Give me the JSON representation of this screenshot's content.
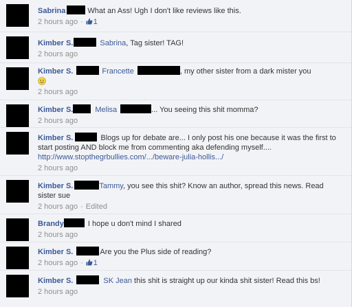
{
  "comments": [
    {
      "name": "Sabrina",
      "tag": "",
      "text": "What an Ass! Ugh I don't like reviews like this.",
      "time": "2 hours ago",
      "likes": "1"
    },
    {
      "name": "Kimber S.",
      "tag": "Sabrina",
      "text": ", Tag sister! TAG!",
      "time": "2 hours ago"
    },
    {
      "name": "Kimber S.",
      "tag": "Francette",
      "text": ", my other sister from a dark mister you",
      "time": "2 hours ago"
    },
    {
      "name": "Kimber S.",
      "tag": "Melisa",
      "text": "... You seeing this shit momma?",
      "time": "2 hours ago"
    },
    {
      "name": "Kimber S.",
      "text": "Blogs up for debate are... I only post his one because it was the first to start posting AND block me from commenting aka defending myself....",
      "link": "http://www.stopthegrbullies.com/.../beware-julia-hollis.../",
      "time": "2 hours ago"
    },
    {
      "name": "Kimber S.",
      "tag": "Tammy",
      "text": ", you see this shit? Know an author, spread this news. Read sister sue",
      "time": "2 hours ago",
      "edited": "Edited"
    },
    {
      "name": "Brandy",
      "text": "I hope u don't mind I shared",
      "time": "2 hours ago"
    },
    {
      "name": "Kimber S.",
      "text": "Are you the Plus side of reading?",
      "time": "2 hours ago",
      "likes": "1"
    },
    {
      "name": "Kimber S.",
      "tag": "SK Jean",
      "text": "this shit is straight up our kinda shit sister! Read this bs!",
      "time": "2 hours ago"
    }
  ],
  "colors": {
    "link": "#3b5998",
    "meta": "#8f8f8f",
    "background": "#f2f3f6"
  },
  "icons": {
    "like": "thumbs-up-icon",
    "emoticon": "smiley-icon"
  }
}
